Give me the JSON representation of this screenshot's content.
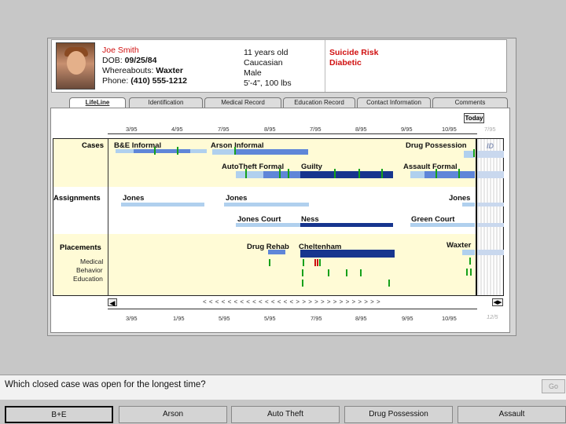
{
  "patient": {
    "name": "Joe Smith",
    "dob_label": "DOB:",
    "dob": "09/25/84",
    "whereabouts_label": "Whereabouts:",
    "whereabouts": "Waxter",
    "phone_label": "Phone:",
    "phone": "(410) 555-1212",
    "age": "11 years old",
    "ethnicity": "Caucasian",
    "gender": "Male",
    "physical": "5'-4\", 100 lbs",
    "alerts": [
      "Suicide Risk",
      "Diabetic"
    ]
  },
  "tabs": [
    "LifeLine",
    "Identification",
    "Medical Record",
    "Education Record",
    "Contact Information",
    "Comments"
  ],
  "today_label": "Today",
  "top_dates": [
    "3/95",
    "4/95",
    "7/95",
    "8/95",
    "7/95",
    "8/95",
    "9/95",
    "10/95",
    "7/95"
  ],
  "bottom_dates": [
    "3/95",
    "1/95",
    "5/95",
    "5/95",
    "7/95",
    "8/95",
    "9/95",
    "10/95",
    "12/5"
  ],
  "rows": {
    "cases": "Cases",
    "assignments": "Assignments",
    "placements": "Placements",
    "medical": "Medical",
    "behavior": "Behavior",
    "education": "Education"
  },
  "labels": {
    "be_informal": "B&E Informal",
    "arson_informal": "Arson Informal",
    "drug_possession": "Drug Possession",
    "autotheft_formal": "AutoTheft Formal",
    "guilty": "Guilty",
    "assault_formal": "Assault Formal",
    "jones1": "Jones",
    "jones2": "Jones",
    "jones3": "Jones",
    "jones_court": "Jones Court",
    "ness": "Ness",
    "green_court": "Green Court",
    "drug_rehab": "Drug Rehab",
    "cheltenham": "Cheltenham",
    "waxter": "Waxter",
    "id_marker": "ID"
  },
  "scroll_text": "< < < < < < < < < < < < < < < > > > > > > > > > > > > > >",
  "question": "Which closed case was open for the longest time?",
  "go_label": "Go",
  "answers": [
    "B+E",
    "Arson",
    "Auto Theft",
    "Drug Possession",
    "Assault"
  ],
  "colors": {
    "cream": "#fffbd6",
    "light_blue": "#b0d0ee",
    "mid_blue": "#5f86d8",
    "dark_blue": "#17358e",
    "event_green": "#16a01a",
    "alert_red": "#d01010"
  }
}
